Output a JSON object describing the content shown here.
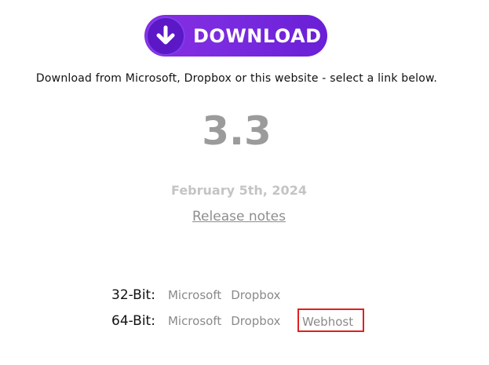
{
  "download_button": {
    "label": "DOWNLOAD",
    "icon": "arrow-down-icon",
    "gradient_start": "#8a2be2",
    "gradient_end": "#6a1fd6"
  },
  "subtitle": "Download from Microsoft, Dropbox or this website - select a link below.",
  "version": "3.3",
  "release_date": "February 5th, 2024",
  "release_notes_link": "Release notes",
  "downloads": {
    "row_32": {
      "label": "32-Bit:",
      "links": [
        "Microsoft",
        "Dropbox"
      ]
    },
    "row_64": {
      "label": "64-Bit:",
      "links": [
        "Microsoft",
        "Dropbox",
        "Webhost"
      ]
    }
  },
  "highlight_color": "#e02020"
}
